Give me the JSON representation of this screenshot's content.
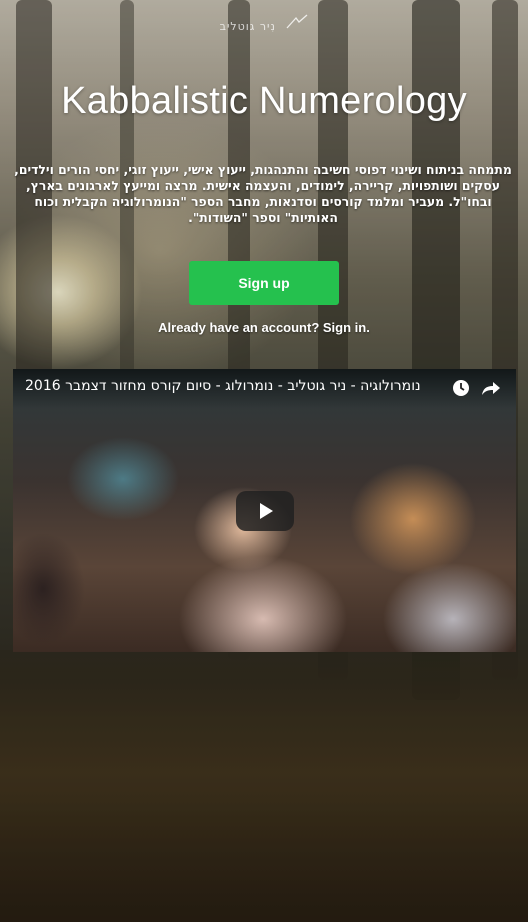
{
  "logo": {
    "text": "נִיר גוטליב"
  },
  "header": {
    "title": "Kabbalistic Numerology"
  },
  "description": "מתמחה בניתוח ושינוי דפוסי חשיבה והתנהגות, ייעוץ אישי, ייעוץ זוגי, יחסי הורים וילדים, עסקים ושותפויות, קריירה, לימודים, והעצמה אישית. מרצה ומייעץ לארגונים בארץ, ובחו\"ל. מעביר ומלמד קורסים וסדנאות, מחבר הספר \"הנומרולוגיה הקבלית וכוח האותיות\" וספר \"השודות\".",
  "signup": {
    "label": "Sign up"
  },
  "signin": {
    "label": "Already have an account? Sign in."
  },
  "video": {
    "title": "נומרולוגיה - ניר גוטליב - נומרולוג - סיום קורס מחזור דצמבר 2016",
    "icons": [
      "clock-icon",
      "share-icon",
      "play-icon"
    ]
  },
  "colors": {
    "accent": "#25c14e"
  }
}
